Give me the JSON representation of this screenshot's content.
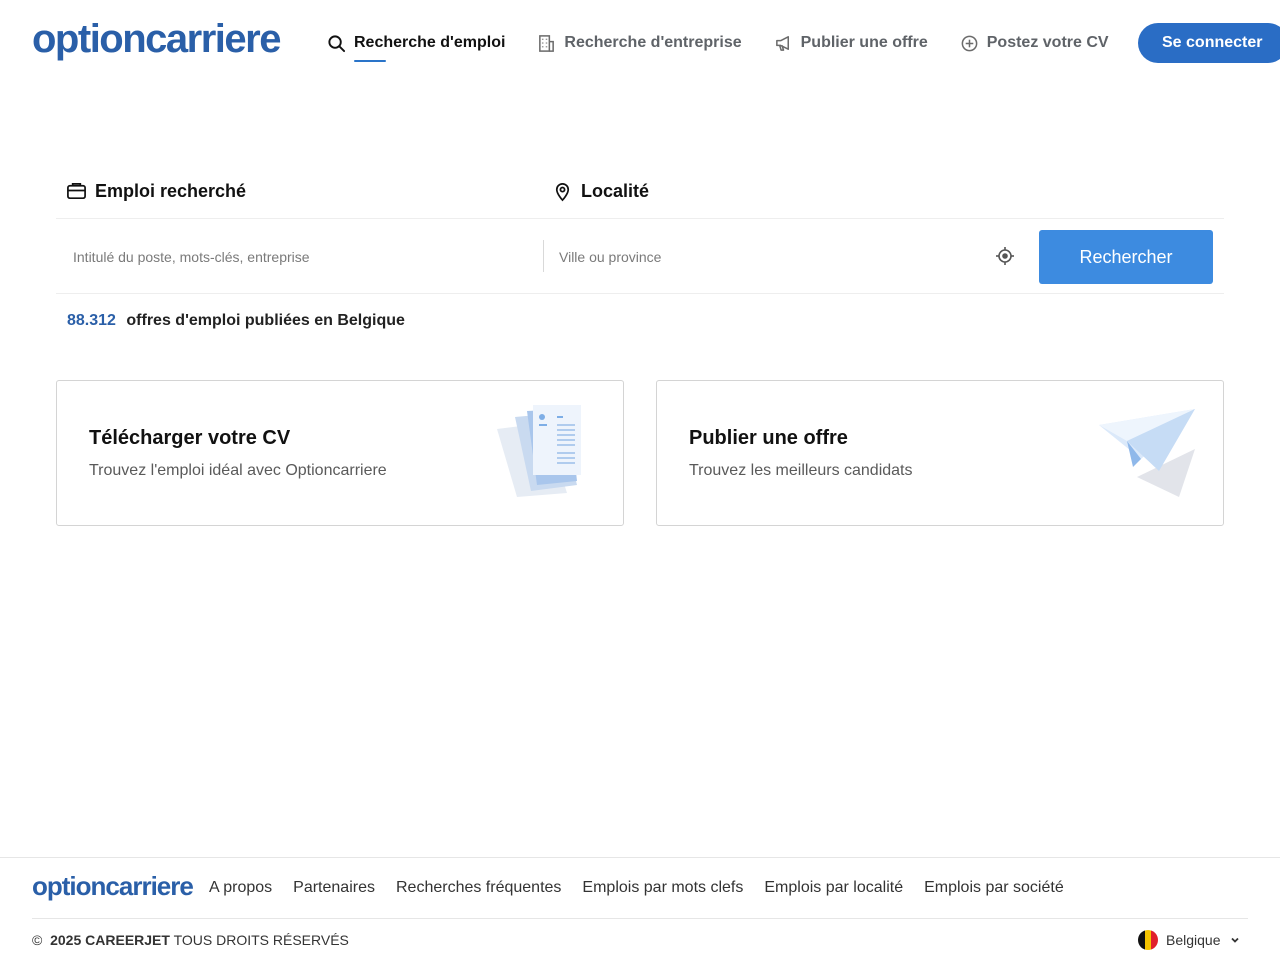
{
  "header": {
    "logo": "optioncarriere",
    "nav": [
      {
        "label": "Recherche d'emploi",
        "icon": "search-icon",
        "active": true
      },
      {
        "label": "Recherche d'entreprise",
        "icon": "building-icon",
        "active": false
      },
      {
        "label": "Publier une offre",
        "icon": "megaphone-icon",
        "active": false
      },
      {
        "label": "Postez votre CV",
        "icon": "plus-circle-icon",
        "active": false
      }
    ],
    "login_label": "Se connecter"
  },
  "search": {
    "job_label": "Emploi recherché",
    "job_placeholder": "Intitulé du poste, mots-clés, entreprise",
    "location_label": "Localité",
    "location_placeholder": "Ville ou province",
    "button_label": "Rechercher"
  },
  "stats": {
    "count": "88.312",
    "text": "offres d'emploi publiées en Belgique"
  },
  "cards": [
    {
      "title": "Télécharger votre CV",
      "subtitle": "Trouvez l'emploi idéal avec Optioncarriere",
      "icon": "documents-illustration"
    },
    {
      "title": "Publier une offre",
      "subtitle": "Trouvez les meilleurs candidats",
      "icon": "paper-plane-illustration"
    }
  ],
  "footer": {
    "logo": "optioncarriere",
    "links": [
      "A propos",
      "Partenaires",
      "Recherches fréquentes",
      "Emplois par mots clefs",
      "Emplois par localité",
      "Emplois par société"
    ],
    "copyright_symbol": "©",
    "copyright_year_brand": "2025 CAREERJET",
    "copyright_rest": "TOUS DROITS RÉSERVÉS",
    "country": "Belgique"
  },
  "colors": {
    "brand": "#2a5fa8",
    "button": "#3d8be0",
    "login": "#2a6dc5"
  }
}
